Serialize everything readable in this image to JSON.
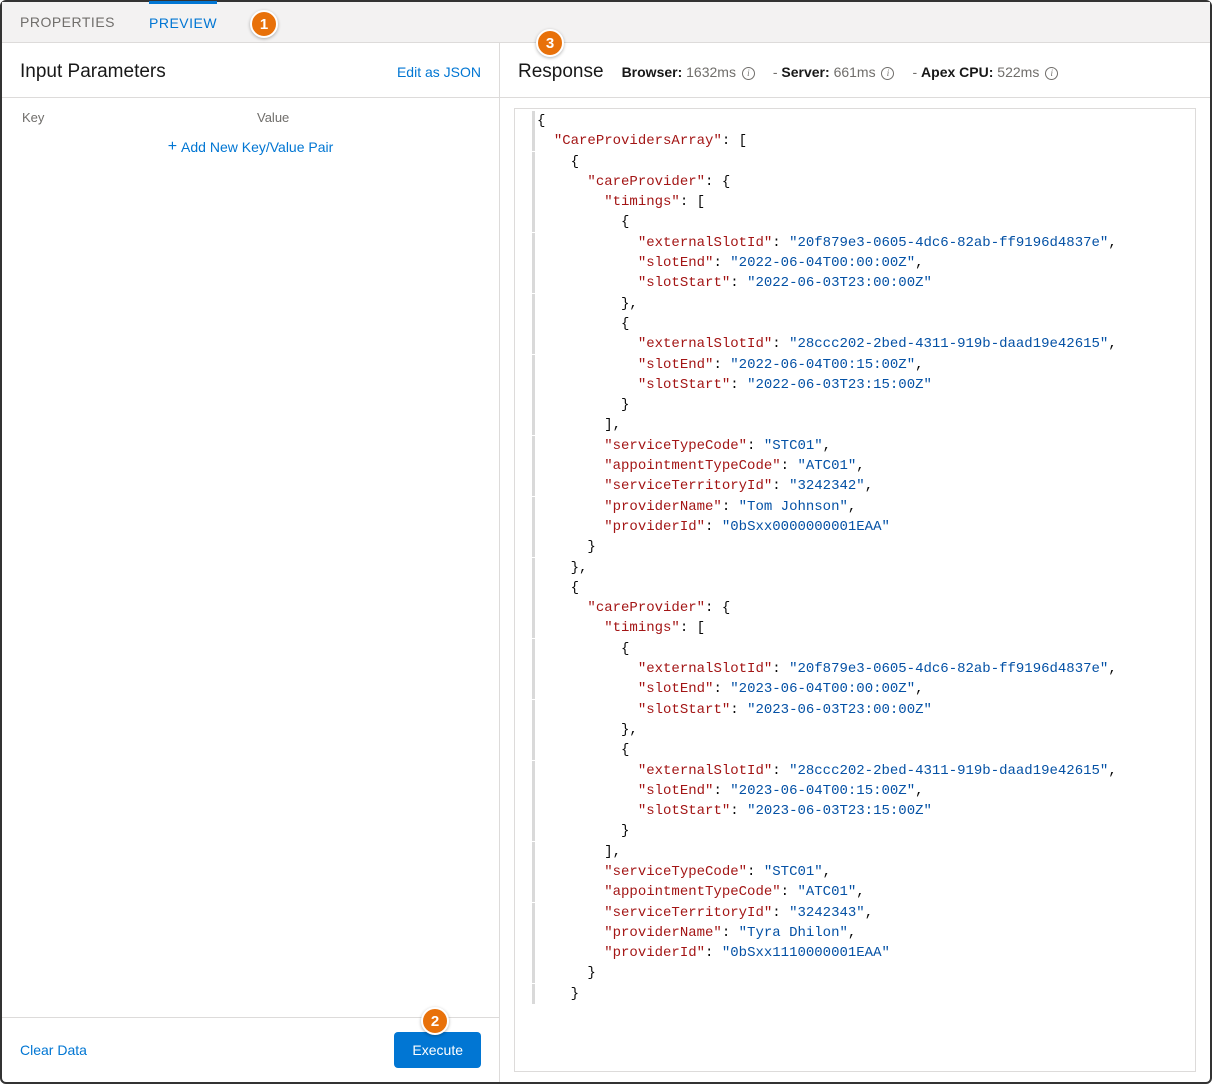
{
  "tabs": {
    "properties": "PROPERTIES",
    "preview": "PREVIEW"
  },
  "badges": {
    "one": "1",
    "two": "2",
    "three": "3"
  },
  "left": {
    "title": "Input Parameters",
    "edit_json": "Edit as JSON",
    "key_header": "Key",
    "value_header": "Value",
    "add_pair": "Add New Key/Value Pair",
    "clear_data": "Clear Data",
    "execute": "Execute"
  },
  "right": {
    "title": "Response",
    "browser_label": "Browser:",
    "browser_value": "1632ms",
    "server_label": "Server:",
    "server_value": "661ms",
    "apex_label": "Apex CPU:",
    "apex_value": "522ms",
    "sep": " - "
  },
  "response_json": {
    "CareProvidersArray": [
      {
        "careProvider": {
          "timings": [
            {
              "externalSlotId": "20f879e3-0605-4dc6-82ab-ff9196d4837e",
              "slotEnd": "2022-06-04T00:00:00Z",
              "slotStart": "2022-06-03T23:00:00Z"
            },
            {
              "externalSlotId": "28ccc202-2bed-4311-919b-daad19e42615",
              "slotEnd": "2022-06-04T00:15:00Z",
              "slotStart": "2022-06-03T23:15:00Z"
            }
          ],
          "serviceTypeCode": "STC01",
          "appointmentTypeCode": "ATC01",
          "serviceTerritoryId": "3242342",
          "providerName": "Tom Johnson",
          "providerId": "0bSxx0000000001EAA"
        }
      },
      {
        "careProvider": {
          "timings": [
            {
              "externalSlotId": "20f879e3-0605-4dc6-82ab-ff9196d4837e",
              "slotEnd": "2023-06-04T00:00:00Z",
              "slotStart": "2023-06-03T23:00:00Z"
            },
            {
              "externalSlotId": "28ccc202-2bed-4311-919b-daad19e42615",
              "slotEnd": "2023-06-04T00:15:00Z",
              "slotStart": "2023-06-03T23:15:00Z"
            }
          ],
          "serviceTypeCode": "STC01",
          "appointmentTypeCode": "ATC01",
          "serviceTerritoryId": "3242343",
          "providerName": "Tyra Dhilon",
          "providerId": "0bSxx1110000001EAA"
        }
      }
    ]
  }
}
